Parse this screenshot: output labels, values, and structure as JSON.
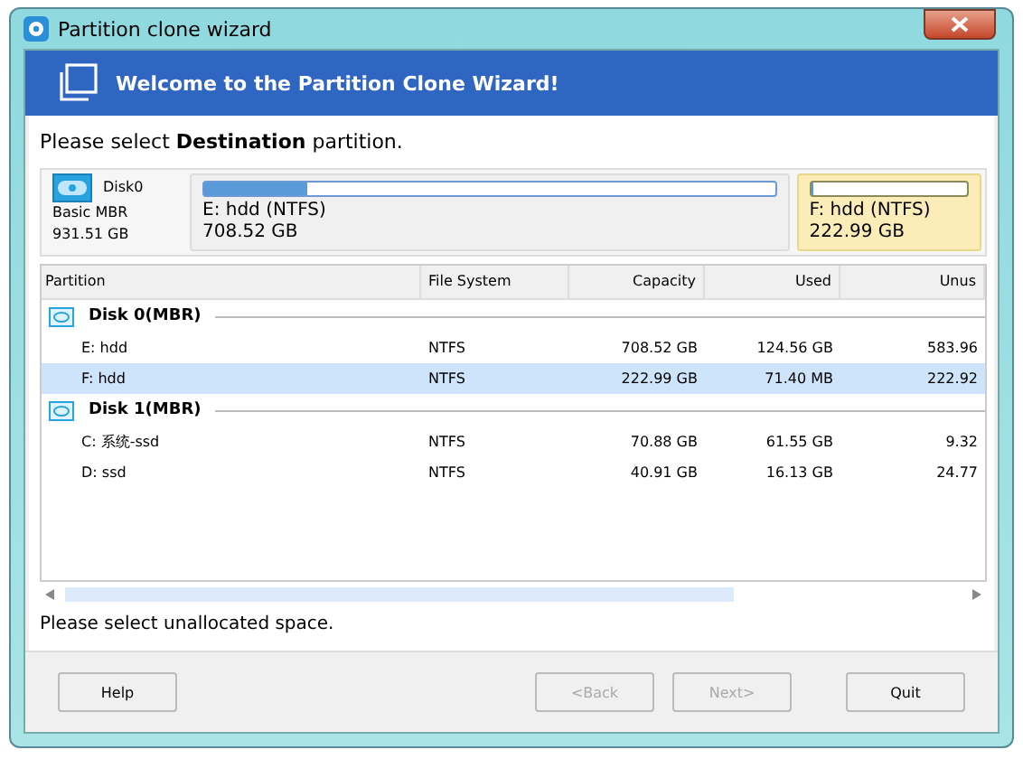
{
  "window": {
    "title": "Partition clone wizard"
  },
  "header": {
    "title": "Welcome to the Partition Clone Wizard!"
  },
  "instruction": "Please select **Destination** partition.",
  "disk_map": {
    "disk": {
      "name": "Disk0",
      "type": "Basic MBR",
      "size": "931.51 GB"
    },
    "partitions": [
      {
        "label": "E: hdd (NTFS)",
        "size": "708.52 GB",
        "level": 0.18,
        "selected": false
      },
      {
        "label": "F: hdd (NTFS)",
        "size": "222.99 GB",
        "level": 0,
        "selected": true
      }
    ]
  },
  "table": {
    "columns": [
      "Partition",
      "File System",
      "Capacity",
      "Used",
      "Unus"
    ],
    "groups": [
      {
        "disk": "Disk 0(MBR)",
        "rows": [
          {
            "cells": [
              "E: hdd",
              "NTFS",
              "708.52 GB",
              "124.56 GB",
              "583.96"
            ],
            "selected": false
          },
          {
            "cells": [
              "F: hdd",
              "NTFS",
              "222.99 GB",
              "71.40 MB",
              "222.92"
            ],
            "selected": true
          }
        ]
      },
      {
        "disk": "Disk 1(MBR)",
        "rows": [
          {
            "cells": [
              "C: 系统-ssd",
              "NTFS",
              "70.88 GB",
              "61.55 GB",
              "9.32"
            ],
            "selected": false
          },
          {
            "cells": [
              "D: ssd",
              "NTFS",
              "40.91 GB",
              "16.13 GB",
              "24.77"
            ],
            "selected": false
          }
        ]
      }
    ]
  },
  "status": "Please select unallocated space.",
  "buttons": [
    {
      "label": "Help",
      "disabled": false
    },
    {
      "label": "<Back",
      "disabled": true
    },
    {
      "label": "Next>",
      "disabled": true
    },
    {
      "label": "Quit",
      "disabled": false
    }
  ]
}
